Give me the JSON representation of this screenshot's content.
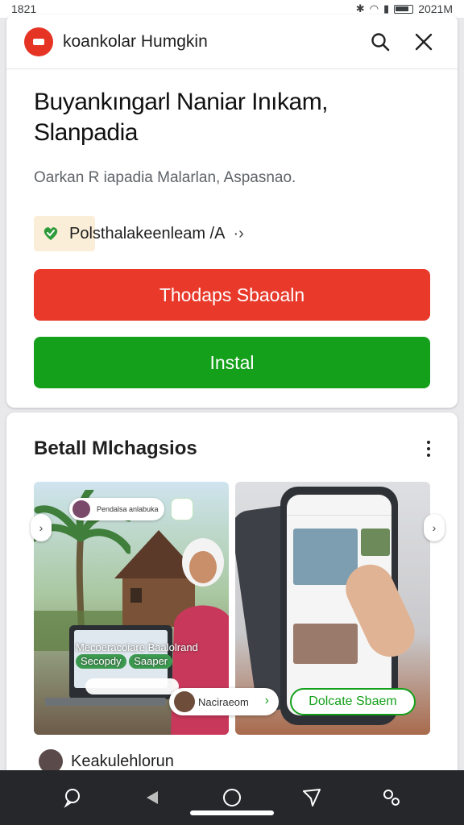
{
  "status_bar": {
    "time": "1821",
    "right_text": "2021M"
  },
  "header": {
    "app_name": "koankolar Humgkin",
    "brand_color": "#e53424"
  },
  "listing": {
    "title": "Buyankıngarl Naniar Inıkam, Slanpadia",
    "subtitle": "Oarkan R iapadia Malarlan, Aspasnao.",
    "chip_label": "Polsthalakeenleam /A",
    "primary_button": "Thodaps Sbaoaln",
    "install_button": "Instal",
    "primary_color": "#e8392a",
    "install_color": "#14a01b"
  },
  "gallery": {
    "section_title": "Betall Mlchagsios",
    "shot1": {
      "mini_card_text": "Pendalsa anlabuka",
      "overlay_line1": "Mecoeracoiare",
      "overlay_line2": "Baalolrand",
      "overlay_tag1": "Secopdy",
      "overlay_tag2": "Saaper",
      "bubble_text": "Naciraeom"
    },
    "shot2": {
      "pill_text": "Dolcate Sbaem"
    }
  },
  "review": {
    "name": "Keakulehlorun"
  }
}
